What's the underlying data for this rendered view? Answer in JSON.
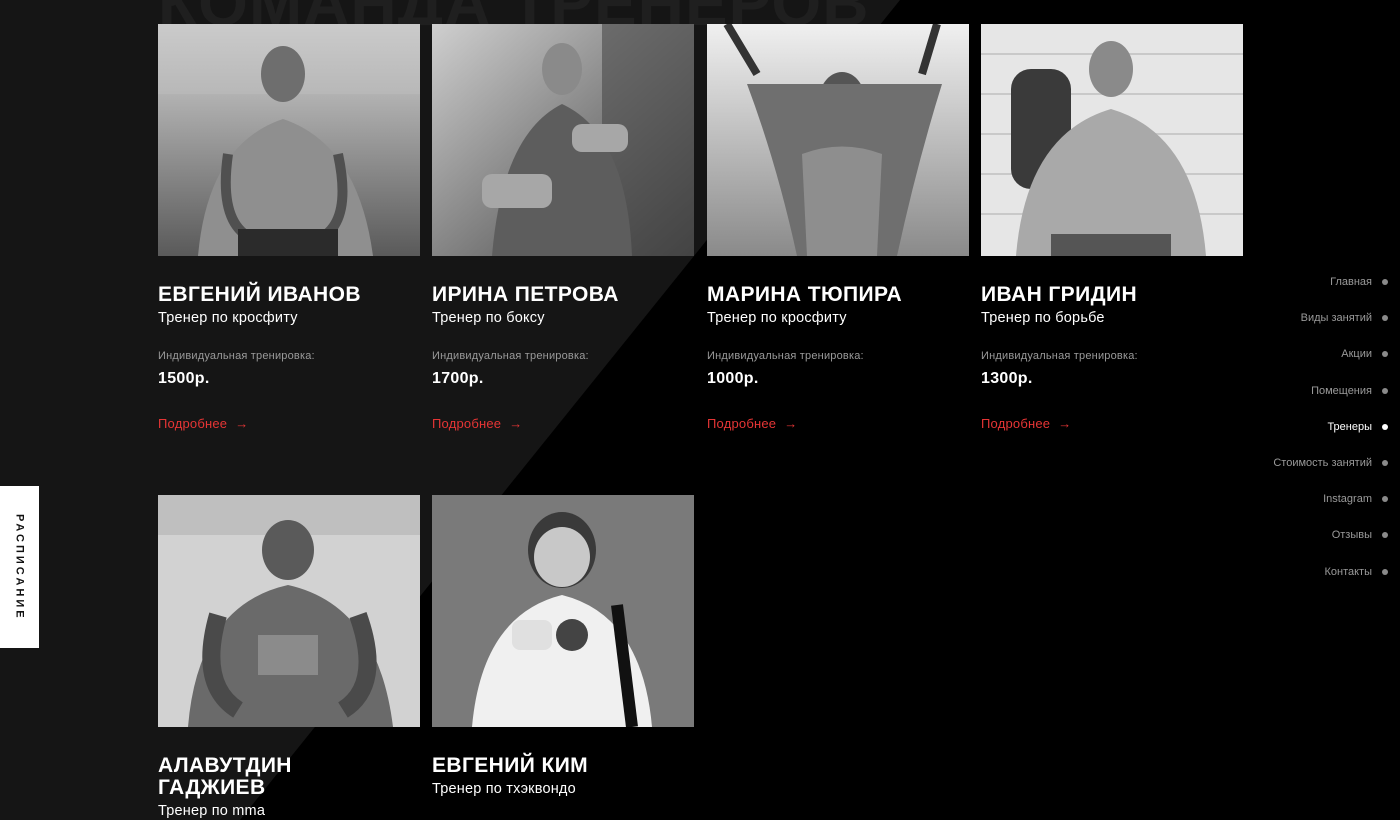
{
  "section": {
    "title": "КОМАНДА ТРЕНЕРОВ"
  },
  "trainers": [
    {
      "name": "ЕВГЕНИЙ ИВАНОВ",
      "role": "Тренер по кросфиту",
      "price_label": "Индивидуальная тренировка:",
      "price": "1500р.",
      "more": "Подробнее"
    },
    {
      "name": "ИРИНА ПЕТРОВА",
      "role": "Тренер по боксу",
      "price_label": "Индивидуальная тренировка:",
      "price": "1700р.",
      "more": "Подробнее"
    },
    {
      "name": "МАРИНА ТЮПИРА",
      "role": "Тренер по кросфиту",
      "price_label": "Индивидуальная тренировка:",
      "price": "1000р.",
      "more": "Подробнее"
    },
    {
      "name": "ИВАН ГРИДИН",
      "role": "Тренер по борьбе",
      "price_label": "Индивидуальная тренировка:",
      "price": "1300р.",
      "more": "Подробнее"
    },
    {
      "name": "АЛАВУТДИН ГАДЖИЕВ",
      "role": "Тренер по mma"
    },
    {
      "name": "ЕВГЕНИЙ КИМ",
      "role": "Тренер по тхэквондо"
    }
  ],
  "nav": {
    "items": [
      {
        "label": "Главная"
      },
      {
        "label": "Виды занятий"
      },
      {
        "label": "Акции"
      },
      {
        "label": "Помещения"
      },
      {
        "label": "Тренеры",
        "active": true
      },
      {
        "label": "Стоимость занятий"
      },
      {
        "label": "Instagram"
      },
      {
        "label": "Отзывы"
      },
      {
        "label": "Контакты"
      }
    ]
  },
  "schedule_tab": {
    "label": "РАСПИСАНИЕ"
  },
  "colors": {
    "accent": "#e53535",
    "bg_light": "#151515",
    "bg_dark": "#000000"
  },
  "icons": {
    "more_arrow": "arrow-right-icon"
  }
}
